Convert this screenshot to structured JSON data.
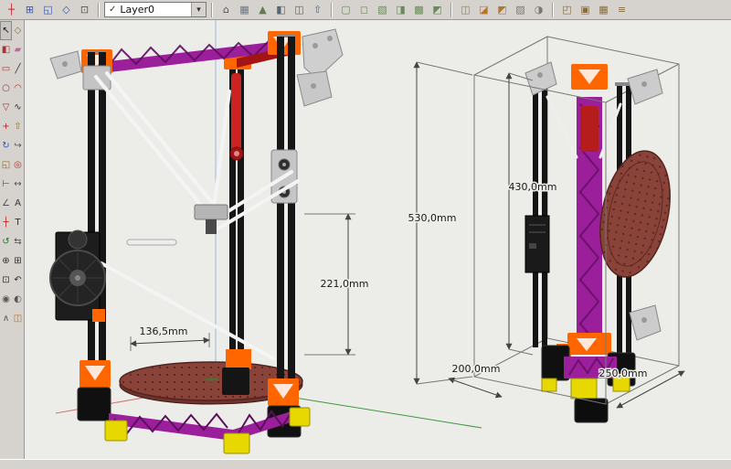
{
  "top_toolbar": {
    "layer_combo": {
      "check": "✓",
      "value": "Layer0",
      "arrow": "▾"
    },
    "g1": [
      {
        "name": "axes-display-icon",
        "glyph": "┼",
        "color": "#c22222"
      },
      {
        "name": "top-view-icon",
        "glyph": "⊞",
        "color": "#3355bb"
      },
      {
        "name": "front-view-icon",
        "glyph": "◱",
        "color": "#3355bb"
      },
      {
        "name": "iso-view-icon",
        "glyph": "◇",
        "color": "#3355bb"
      },
      {
        "name": "zoom-extents-icon",
        "glyph": "⊡",
        "color": "#555555"
      }
    ],
    "g2": [
      {
        "name": "home-icon",
        "glyph": "⌂",
        "color": "#445577"
      },
      {
        "name": "building-icon",
        "glyph": "▦",
        "color": "#667788"
      },
      {
        "name": "terrain-icon",
        "glyph": "▲",
        "color": "#667755"
      },
      {
        "name": "place-model-icon",
        "glyph": "◧",
        "color": "#556677"
      },
      {
        "name": "get-models-icon",
        "glyph": "◫",
        "color": "#556677"
      },
      {
        "name": "share-model-icon",
        "glyph": "⇧",
        "color": "#556677"
      }
    ],
    "g3": [
      {
        "name": "xray-mode-icon",
        "glyph": "▢",
        "color": "#6a8a5a"
      },
      {
        "name": "wireframe-mode-icon",
        "glyph": "◻",
        "color": "#6a8a5a"
      },
      {
        "name": "hidden-line-mode-icon",
        "glyph": "▧",
        "color": "#6a8a5a"
      },
      {
        "name": "shaded-mode-icon",
        "glyph": "◨",
        "color": "#6a8a5a"
      },
      {
        "name": "textured-mode-icon",
        "glyph": "▩",
        "color": "#6a8a5a"
      },
      {
        "name": "monochrome-mode-icon",
        "glyph": "◩",
        "color": "#6a8a5a"
      }
    ],
    "g4": [
      {
        "name": "section-plane-toggle-icon",
        "glyph": "◫",
        "color": "#b8762a"
      },
      {
        "name": "section-cuts-icon",
        "glyph": "◪",
        "color": "#b8762a"
      },
      {
        "name": "section-fill-icon",
        "glyph": "◩",
        "color": "#b8762a"
      },
      {
        "name": "back-edges-icon",
        "glyph": "▨",
        "color": "#777777"
      },
      {
        "name": "shadows-icon",
        "glyph": "◑",
        "color": "#777777"
      }
    ],
    "g5": [
      {
        "name": "components-icon",
        "glyph": "◰",
        "color": "#8a6d3b"
      },
      {
        "name": "group-icon",
        "glyph": "▣",
        "color": "#8a6d3b"
      },
      {
        "name": "solid-tools-icon",
        "glyph": "▦",
        "color": "#8a6d3b"
      },
      {
        "name": "outliner-icon",
        "glyph": "≡",
        "color": "#8a6d3b"
      }
    ]
  },
  "left_toolbar": {
    "tools": [
      {
        "name": "select-tool-icon",
        "glyph": "↖",
        "color": "#111111"
      },
      {
        "name": "make-component-icon",
        "glyph": "◇",
        "color": "#8a6d3b"
      },
      {
        "name": "paint-bucket-icon",
        "glyph": "◧",
        "color": "#aa3333"
      },
      {
        "name": "eraser-icon",
        "glyph": "▰",
        "color": "#c2679d"
      },
      {
        "name": "rectangle-tool-icon",
        "glyph": "▭",
        "color": "#b03030"
      },
      {
        "name": "line-tool-icon",
        "glyph": "╱",
        "color": "#333333"
      },
      {
        "name": "circle-tool-icon",
        "glyph": "○",
        "color": "#b03030"
      },
      {
        "name": "arc-tool-icon",
        "glyph": "◠",
        "color": "#b03030"
      },
      {
        "name": "polygon-tool-icon",
        "glyph": "▽",
        "color": "#b03030"
      },
      {
        "name": "freehand-tool-icon",
        "glyph": "∿",
        "color": "#333333"
      },
      {
        "name": "move-tool-icon",
        "glyph": "+",
        "color": "#c22222"
      },
      {
        "name": "push-pull-icon",
        "glyph": "⇧",
        "color": "#8a6d3b"
      },
      {
        "name": "rotate-tool-icon",
        "glyph": "↻",
        "color": "#3355bb"
      },
      {
        "name": "follow-me-icon",
        "glyph": "↪",
        "color": "#555555"
      },
      {
        "name": "scale-tool-icon",
        "glyph": "◱",
        "color": "#8a6d3b"
      },
      {
        "name": "offset-tool-icon",
        "glyph": "◎",
        "color": "#b03030"
      },
      {
        "name": "tape-measure-icon",
        "glyph": "⊢",
        "color": "#555555"
      },
      {
        "name": "dimension-tool-icon",
        "glyph": "↔",
        "color": "#555555"
      },
      {
        "name": "protractor-icon",
        "glyph": "∠",
        "color": "#555555"
      },
      {
        "name": "text-tool-icon",
        "glyph": "A",
        "color": "#333333"
      },
      {
        "name": "axes-tool-icon",
        "glyph": "┼",
        "color": "#c22222"
      },
      {
        "name": "3d-text-icon",
        "glyph": "T",
        "color": "#333333"
      },
      {
        "name": "orbit-tool-icon",
        "glyph": "↺",
        "color": "#227722"
      },
      {
        "name": "pan-tool-icon",
        "glyph": "⇆",
        "color": "#555555"
      },
      {
        "name": "zoom-tool-icon",
        "glyph": "⊕",
        "color": "#333333"
      },
      {
        "name": "zoom-window-icon",
        "glyph": "⊞",
        "color": "#333333"
      },
      {
        "name": "zoom-extents-icon",
        "glyph": "⊡",
        "color": "#333333"
      },
      {
        "name": "previous-view-icon",
        "glyph": "↶",
        "color": "#333333"
      },
      {
        "name": "position-camera-icon",
        "glyph": "◉",
        "color": "#555555"
      },
      {
        "name": "look-around-icon",
        "glyph": "◐",
        "color": "#555555"
      },
      {
        "name": "walk-tool-icon",
        "glyph": "∧",
        "color": "#555555"
      },
      {
        "name": "section-plane-icon",
        "glyph": "◫",
        "color": "#c07020"
      }
    ]
  },
  "canvas": {
    "dimensions": {
      "left_model": {
        "bed_width": "136,5mm",
        "frame_height": "221,0mm"
      },
      "right_model": {
        "total_height": "530,0mm",
        "printer_height": "430,0mm",
        "base_depth": "200,0mm",
        "base_width": "250,0mm"
      }
    }
  },
  "colors": {
    "canvas_bg": "#ecede8",
    "toolbar_bg": "#d6d3ce",
    "accent_orange": "#ff6600",
    "accent_magenta": "#9b1f9b",
    "accent_yellow": "#e6d800",
    "accent_red": "#b51d1d",
    "bed_face": "#8a4339",
    "bed_rim": "#6d332c",
    "axis_green": "#2e8b2e",
    "axis_red": "#cc5555",
    "axis_blue": "#8fa8d8"
  },
  "statusbar": {
    "text": ""
  }
}
